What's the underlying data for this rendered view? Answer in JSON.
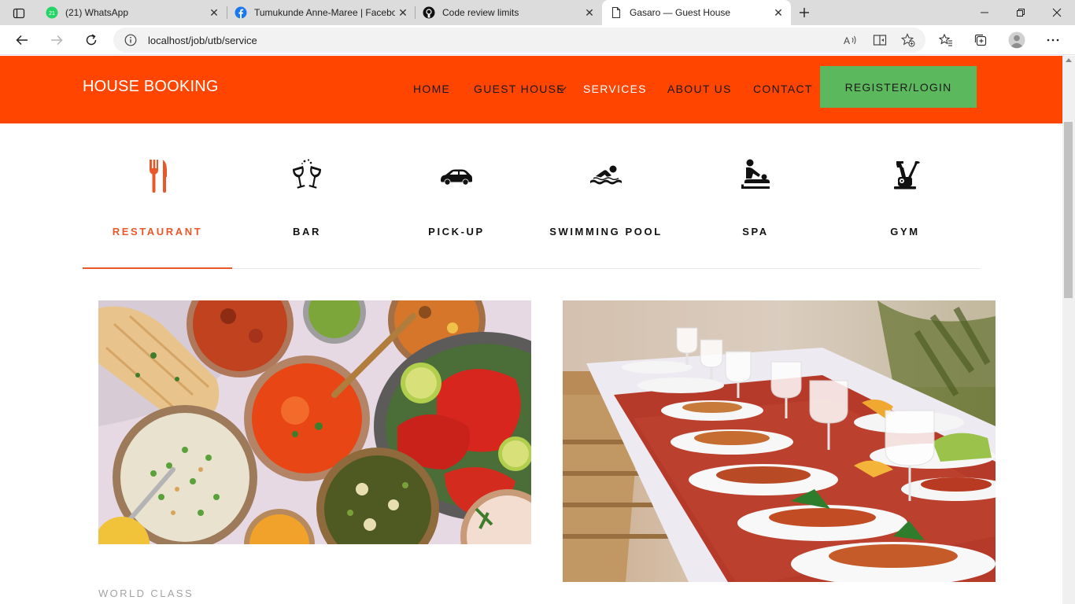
{
  "browser": {
    "tabs": [
      {
        "title": "(21) WhatsApp",
        "badge": "21",
        "favicon": "whatsapp-icon"
      },
      {
        "title": "Tumukunde Anne-Maree | Facebook",
        "favicon": "facebook-icon"
      },
      {
        "title": "Code review limits",
        "favicon": "github-icon"
      },
      {
        "title": "Gasaro — Guest House",
        "favicon": "page-icon",
        "active": true
      }
    ],
    "url": "localhost/job/utb/service"
  },
  "site": {
    "brand": "HOUSE BOOKING",
    "nav": {
      "home": "HOME",
      "guest_house": "GUEST HOUSE",
      "services": "SERVICES",
      "about": "ABOUT US",
      "contact": "CONTACT",
      "register": "REGISTER/LOGIN"
    },
    "services": [
      {
        "label": "RESTAURANT",
        "icon": "cutlery-icon",
        "active": true
      },
      {
        "label": "BAR",
        "icon": "wine-glasses-icon"
      },
      {
        "label": "PICK-UP",
        "icon": "car-icon"
      },
      {
        "label": "SWIMMING POOL",
        "icon": "swimmer-icon"
      },
      {
        "label": "SPA",
        "icon": "massage-icon"
      },
      {
        "label": "GYM",
        "icon": "exercise-bike-icon"
      }
    ],
    "section_eyebrow": "WORLD CLASS"
  },
  "colors": {
    "header": "#ff4500",
    "accent": "#e8582a",
    "register_button": "#5cb85c"
  }
}
